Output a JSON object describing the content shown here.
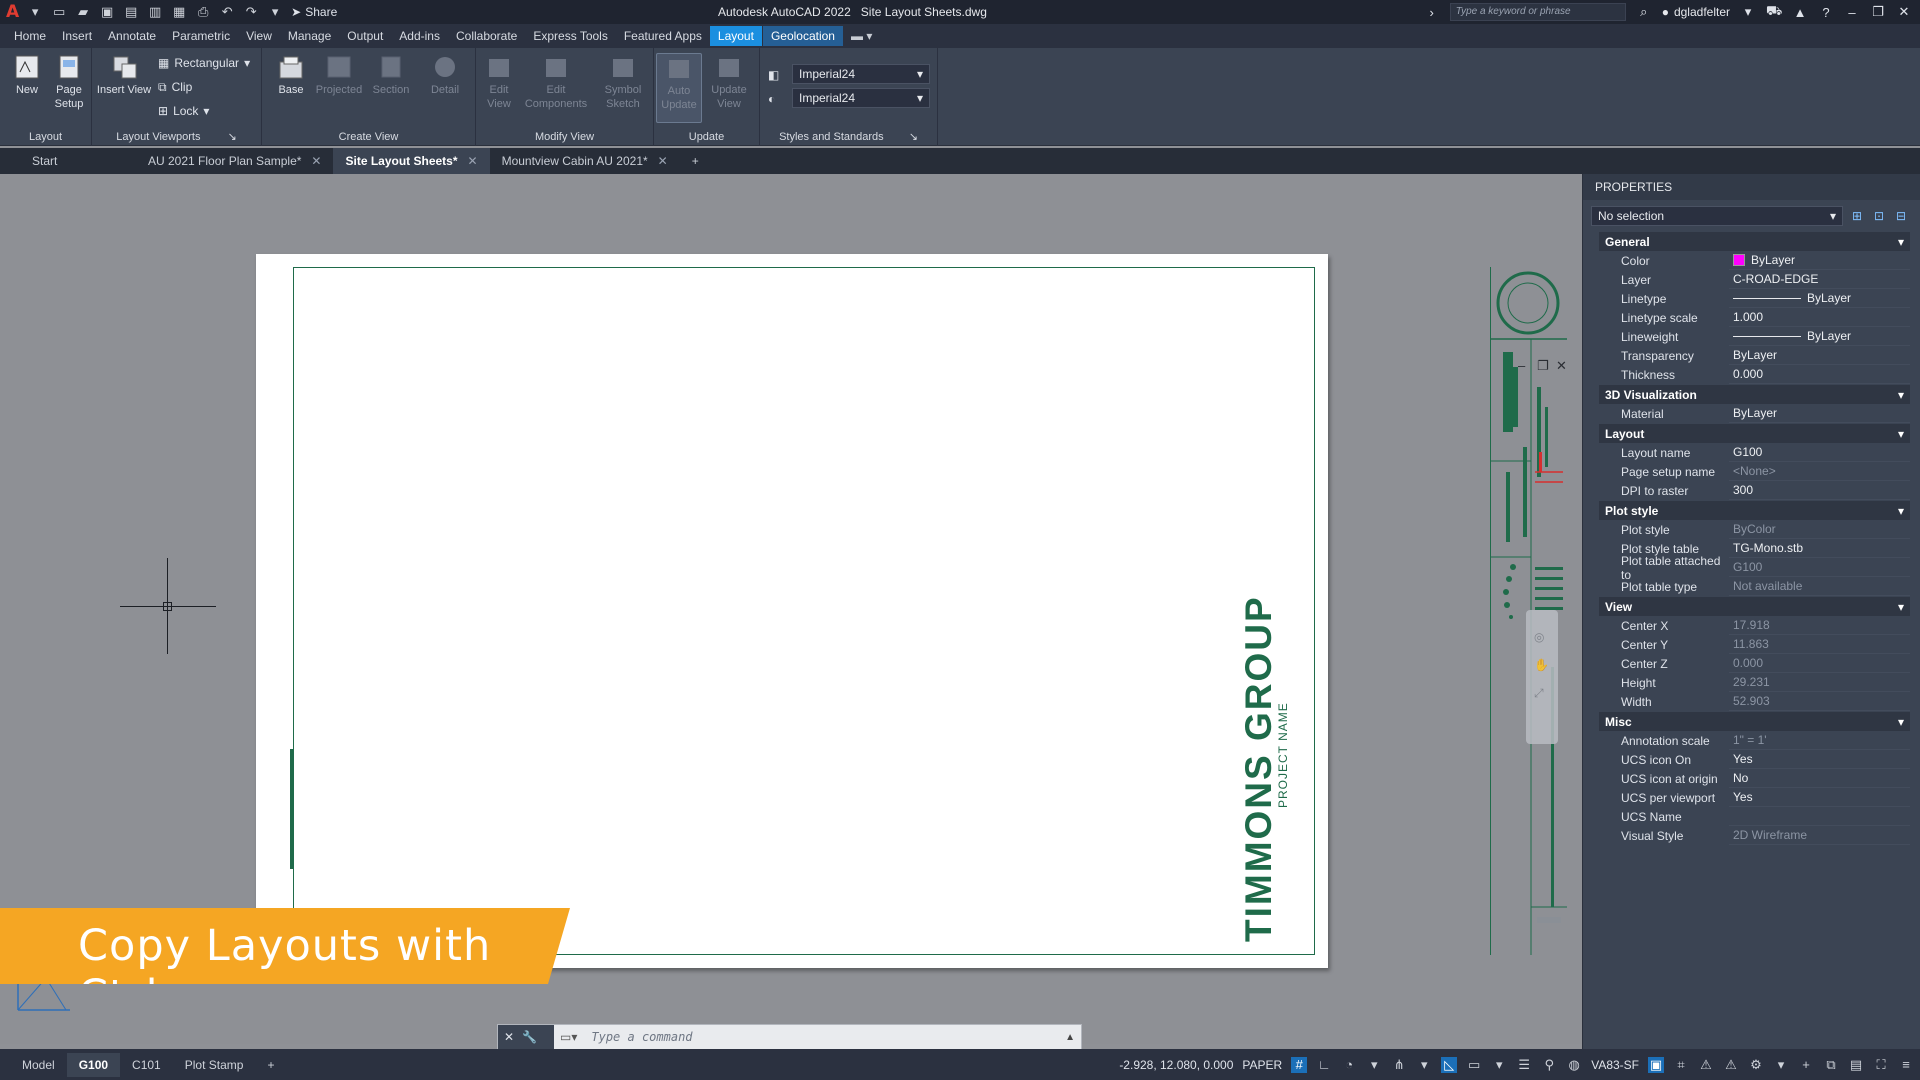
{
  "titlebar": {
    "app_title": "Autodesk AutoCAD 2022",
    "file_name": "Site Layout Sheets.dwg",
    "share_label": "Share",
    "search_placeholder": "Type a keyword or phrase",
    "user_name": "dgladfelter"
  },
  "menu_tabs": [
    "Home",
    "Insert",
    "Annotate",
    "Parametric",
    "View",
    "Manage",
    "Output",
    "Add-ins",
    "Collaborate",
    "Express Tools",
    "Featured Apps",
    "Layout",
    "Geolocation"
  ],
  "active_menu_tab": "Layout",
  "ribbon": {
    "layout_panel": {
      "label": "Layout",
      "new": "New",
      "page_setup_1": "Page",
      "page_setup_2": "Setup"
    },
    "layout_viewports_panel": {
      "label": "Layout Viewports",
      "insert_view": "Insert View",
      "rectangular": "Rectangular",
      "clip": "Clip",
      "lock": "Lock"
    },
    "create_view_panel": {
      "label": "Create View",
      "base": "Base",
      "projected": "Projected",
      "section": "Section",
      "detail": "Detail"
    },
    "modify_view_panel": {
      "label": "Modify View",
      "edit_view_1": "Edit",
      "edit_view_2": "View",
      "edit_comp_1": "Edit",
      "edit_comp_2": "Components",
      "symbol_1": "Symbol",
      "symbol_2": "Sketch"
    },
    "update_panel": {
      "label": "Update",
      "auto_1": "Auto",
      "auto_2": "Update",
      "update_1": "Update",
      "update_2": "View"
    },
    "styles_panel": {
      "label": "Styles and Standards",
      "style1": "Imperial24",
      "style2": "Imperial24"
    }
  },
  "doc_tabs": [
    {
      "label": "Start",
      "closable": false
    },
    {
      "label": "AU 2021 Floor Plan Sample*",
      "closable": true
    },
    {
      "label": "Site Layout Sheets*",
      "closable": true
    },
    {
      "label": "Mountview Cabin AU 2021*",
      "closable": true
    }
  ],
  "sheet": {
    "company": "TIMMONS GROUP",
    "project": "PROJECT NAME"
  },
  "banner": {
    "text": "Copy Layouts with Ctrl"
  },
  "command_line": {
    "placeholder": "Type a command"
  },
  "layout_tabs": [
    "Model",
    "G100",
    "C101",
    "Plot Stamp"
  ],
  "active_layout_tab": "G100",
  "status": {
    "coords": "-2.928, 12.080, 0.000",
    "space": "PAPER",
    "va_label": "VA83-SF"
  },
  "properties": {
    "title": "PROPERTIES",
    "selection": "No selection",
    "categories": [
      {
        "name": "General",
        "rows": [
          {
            "name": "Color",
            "value": "ByLayer"
          },
          {
            "name": "Layer",
            "value": "C-ROAD-EDGE"
          },
          {
            "name": "Linetype",
            "value": "ByLayer"
          },
          {
            "name": "Linetype scale",
            "value": "1.000"
          },
          {
            "name": "Lineweight",
            "value": "ByLayer"
          },
          {
            "name": "Transparency",
            "value": "ByLayer"
          },
          {
            "name": "Thickness",
            "value": "0.000"
          }
        ]
      },
      {
        "name": "3D Visualization",
        "rows": [
          {
            "name": "Material",
            "value": "ByLayer"
          }
        ]
      },
      {
        "name": "Layout",
        "rows": [
          {
            "name": "Layout name",
            "value": "G100"
          },
          {
            "name": "Page setup name",
            "value": "<None>"
          },
          {
            "name": "DPI to raster",
            "value": "300"
          }
        ]
      },
      {
        "name": "Plot style",
        "rows": [
          {
            "name": "Plot style",
            "value": "ByColor"
          },
          {
            "name": "Plot style table",
            "value": "TG-Mono.stb"
          },
          {
            "name": "Plot table attached to",
            "value": "G100"
          },
          {
            "name": "Plot table type",
            "value": "Not available"
          }
        ]
      },
      {
        "name": "View",
        "rows": [
          {
            "name": "Center X",
            "value": "17.918"
          },
          {
            "name": "Center Y",
            "value": "11.863"
          },
          {
            "name": "Center Z",
            "value": "0.000"
          },
          {
            "name": "Height",
            "value": "29.231"
          },
          {
            "name": "Width",
            "value": "52.903"
          }
        ]
      },
      {
        "name": "Misc",
        "rows": [
          {
            "name": "Annotation scale",
            "value": "1\" = 1'"
          },
          {
            "name": "UCS icon On",
            "value": "Yes"
          },
          {
            "name": "UCS icon at origin",
            "value": "No"
          },
          {
            "name": "UCS per viewport",
            "value": "Yes"
          },
          {
            "name": "UCS Name",
            "value": ""
          },
          {
            "name": "Visual Style",
            "value": "2D Wireframe"
          }
        ]
      }
    ]
  },
  "colors": {
    "accent": "#1b8fe0",
    "sheet_green": "#1f6b4a",
    "banner": "#f5a623",
    "color_swatch": "#ff00ff"
  }
}
